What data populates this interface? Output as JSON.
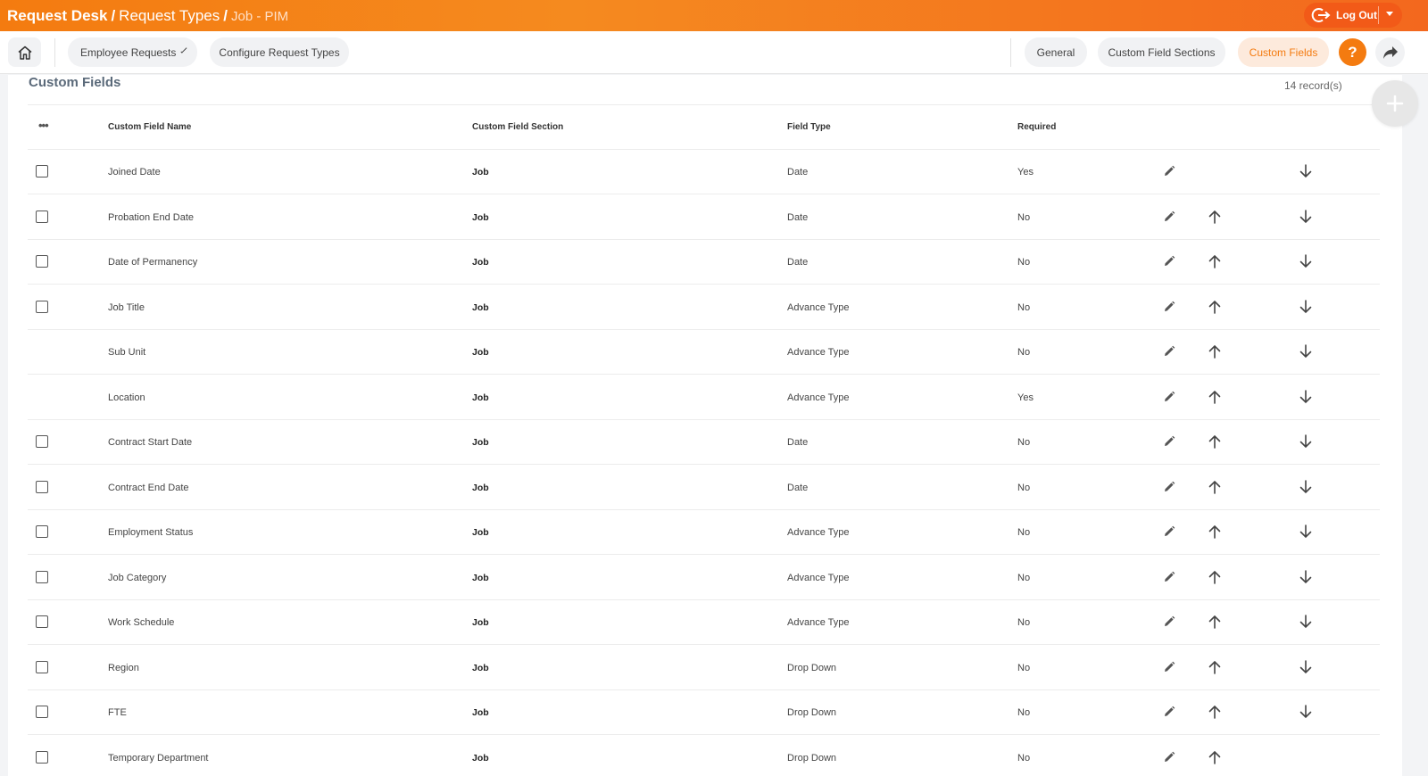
{
  "header": {
    "crumb1": "Request Desk",
    "crumb2": "Request Types",
    "crumb3": "Job - PIM",
    "separator": "/",
    "logout_label": "Log Out",
    "bg_color": "#f47b10"
  },
  "subnav": {
    "employee_requests": "Employee Requests",
    "configure_request_types": "Configure Request Types",
    "tab_general": "General",
    "tab_custom_field_sections": "Custom Field Sections",
    "tab_custom_fields": "Custom Fields",
    "help_label": "?",
    "accent_color": "#f47b10"
  },
  "card": {
    "title": "Custom Fields",
    "record_count": "14 record(s)"
  },
  "table": {
    "more_label": "•••",
    "columns": {
      "name": "Custom Field Name",
      "section": "Custom Field Section",
      "type": "Field Type",
      "required": "Required"
    },
    "rows": [
      {
        "name": "Joined Date",
        "section": "Job",
        "type": "Date",
        "required": "Yes",
        "checkbox": true,
        "up": false,
        "down": true
      },
      {
        "name": "Probation End Date",
        "section": "Job",
        "type": "Date",
        "required": "No",
        "checkbox": true,
        "up": true,
        "down": true
      },
      {
        "name": "Date of Permanency",
        "section": "Job",
        "type": "Date",
        "required": "No",
        "checkbox": true,
        "up": true,
        "down": true
      },
      {
        "name": "Job Title",
        "section": "Job",
        "type": "Advance Type",
        "required": "No",
        "checkbox": true,
        "up": true,
        "down": true
      },
      {
        "name": "Sub Unit",
        "section": "Job",
        "type": "Advance Type",
        "required": "No",
        "checkbox": false,
        "up": true,
        "down": true
      },
      {
        "name": "Location",
        "section": "Job",
        "type": "Advance Type",
        "required": "Yes",
        "checkbox": false,
        "up": true,
        "down": true
      },
      {
        "name": "Contract Start Date",
        "section": "Job",
        "type": "Date",
        "required": "No",
        "checkbox": true,
        "up": true,
        "down": true
      },
      {
        "name": "Contract End Date",
        "section": "Job",
        "type": "Date",
        "required": "No",
        "checkbox": true,
        "up": true,
        "down": true
      },
      {
        "name": "Employment Status",
        "section": "Job",
        "type": "Advance Type",
        "required": "No",
        "checkbox": true,
        "up": true,
        "down": true
      },
      {
        "name": "Job Category",
        "section": "Job",
        "type": "Advance Type",
        "required": "No",
        "checkbox": true,
        "up": true,
        "down": true
      },
      {
        "name": "Work Schedule",
        "section": "Job",
        "type": "Advance Type",
        "required": "No",
        "checkbox": true,
        "up": true,
        "down": true
      },
      {
        "name": "Region",
        "section": "Job",
        "type": "Drop Down",
        "required": "No",
        "checkbox": true,
        "up": true,
        "down": true
      },
      {
        "name": "FTE",
        "section": "Job",
        "type": "Drop Down",
        "required": "No",
        "checkbox": true,
        "up": true,
        "down": true
      },
      {
        "name": "Temporary Department",
        "section": "Job",
        "type": "Drop Down",
        "required": "No",
        "checkbox": true,
        "up": true,
        "down": false
      }
    ],
    "icons": {
      "edit": "pencil-icon",
      "up": "arrow-up-icon",
      "down": "arrow-down-icon"
    }
  }
}
